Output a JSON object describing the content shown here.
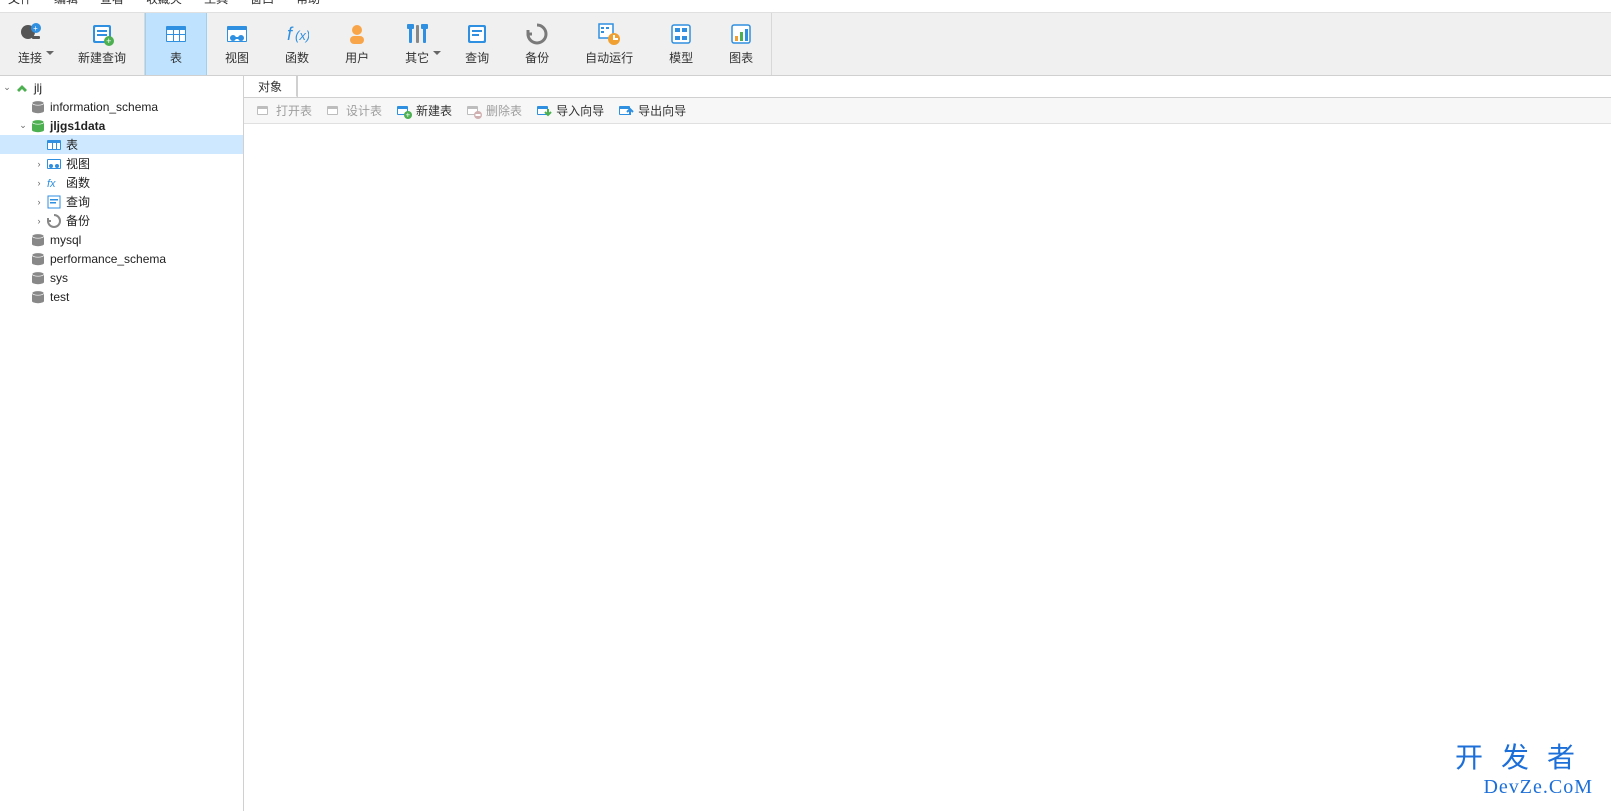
{
  "menu": {
    "items": [
      "文件",
      "编辑",
      "查看",
      "收藏夹",
      "工具",
      "窗口",
      "帮助"
    ]
  },
  "toolbar": {
    "groups": [
      {
        "items": [
          {
            "name": "connect",
            "label": "连接",
            "accent": "#2f8fe0",
            "shape": "plug",
            "drop": true
          },
          {
            "name": "new-query",
            "label": "新建查询",
            "accent": "#2f8fe0",
            "shape": "query"
          }
        ]
      },
      {
        "items": [
          {
            "name": "table",
            "label": "表",
            "accent": "#2f8fe0",
            "shape": "table",
            "active": true
          },
          {
            "name": "view",
            "label": "视图",
            "accent": "#2f8fe0",
            "shape": "view"
          },
          {
            "name": "function",
            "label": "函数",
            "accent": "#2f8fe0",
            "shape": "fx"
          },
          {
            "name": "user",
            "label": "用户",
            "accent": "#f8a54a",
            "shape": "user"
          },
          {
            "name": "other",
            "label": "其它",
            "accent": "#2f8fe0",
            "shape": "tools",
            "drop": true
          },
          {
            "name": "query",
            "label": "查询",
            "accent": "#2f8fe0",
            "shape": "query2"
          },
          {
            "name": "backup",
            "label": "备份",
            "accent": "#7a7a7a",
            "shape": "backup"
          },
          {
            "name": "autorun",
            "label": "自动运行",
            "accent": "#2f8fe0",
            "shape": "schedule"
          },
          {
            "name": "model",
            "label": "模型",
            "accent": "#2f8fe0",
            "shape": "model"
          },
          {
            "name": "chart",
            "label": "图表",
            "accent": "#2f8fe0",
            "shape": "chart"
          }
        ]
      }
    ]
  },
  "sidebar": {
    "nodes": [
      {
        "depth": 0,
        "expander": "open",
        "icon": "conn-green",
        "label": "jlj",
        "bold": false
      },
      {
        "depth": 1,
        "expander": "none",
        "icon": "db-gray",
        "label": "information_schema"
      },
      {
        "depth": 1,
        "expander": "open",
        "icon": "db-green",
        "label": "jljgs1data",
        "bold": true
      },
      {
        "depth": 2,
        "expander": "none",
        "icon": "table-blue",
        "label": "表",
        "selected": true
      },
      {
        "depth": 2,
        "expander": "closed",
        "icon": "view-blue",
        "label": "视图"
      },
      {
        "depth": 2,
        "expander": "closed",
        "icon": "fx-blue",
        "label": "函数"
      },
      {
        "depth": 2,
        "expander": "closed",
        "icon": "query-blue",
        "label": "查询"
      },
      {
        "depth": 2,
        "expander": "closed",
        "icon": "backup-gray",
        "label": "备份"
      },
      {
        "depth": 1,
        "expander": "none",
        "icon": "db-gray",
        "label": "mysql"
      },
      {
        "depth": 1,
        "expander": "none",
        "icon": "db-gray",
        "label": "performance_schema"
      },
      {
        "depth": 1,
        "expander": "none",
        "icon": "db-gray",
        "label": "sys"
      },
      {
        "depth": 1,
        "expander": "none",
        "icon": "db-gray",
        "label": "test"
      }
    ]
  },
  "content": {
    "tabs": [
      {
        "label": "对象",
        "active": true
      }
    ],
    "subtoolbar": [
      {
        "name": "open-table",
        "label": "打开表",
        "icon": "table-open",
        "disabled": true
      },
      {
        "name": "design-table",
        "label": "设计表",
        "icon": "table-design",
        "disabled": true
      },
      {
        "name": "new-table",
        "label": "新建表",
        "icon": "table-new",
        "disabled": false
      },
      {
        "name": "delete-table",
        "label": "删除表",
        "icon": "table-delete",
        "disabled": true
      },
      {
        "name": "import-wizard",
        "label": "导入向导",
        "icon": "import",
        "disabled": false
      },
      {
        "name": "export-wizard",
        "label": "导出向导",
        "icon": "export",
        "disabled": false
      }
    ]
  },
  "watermark": {
    "line1": "开发者",
    "line2": "DevZe.CoM"
  }
}
